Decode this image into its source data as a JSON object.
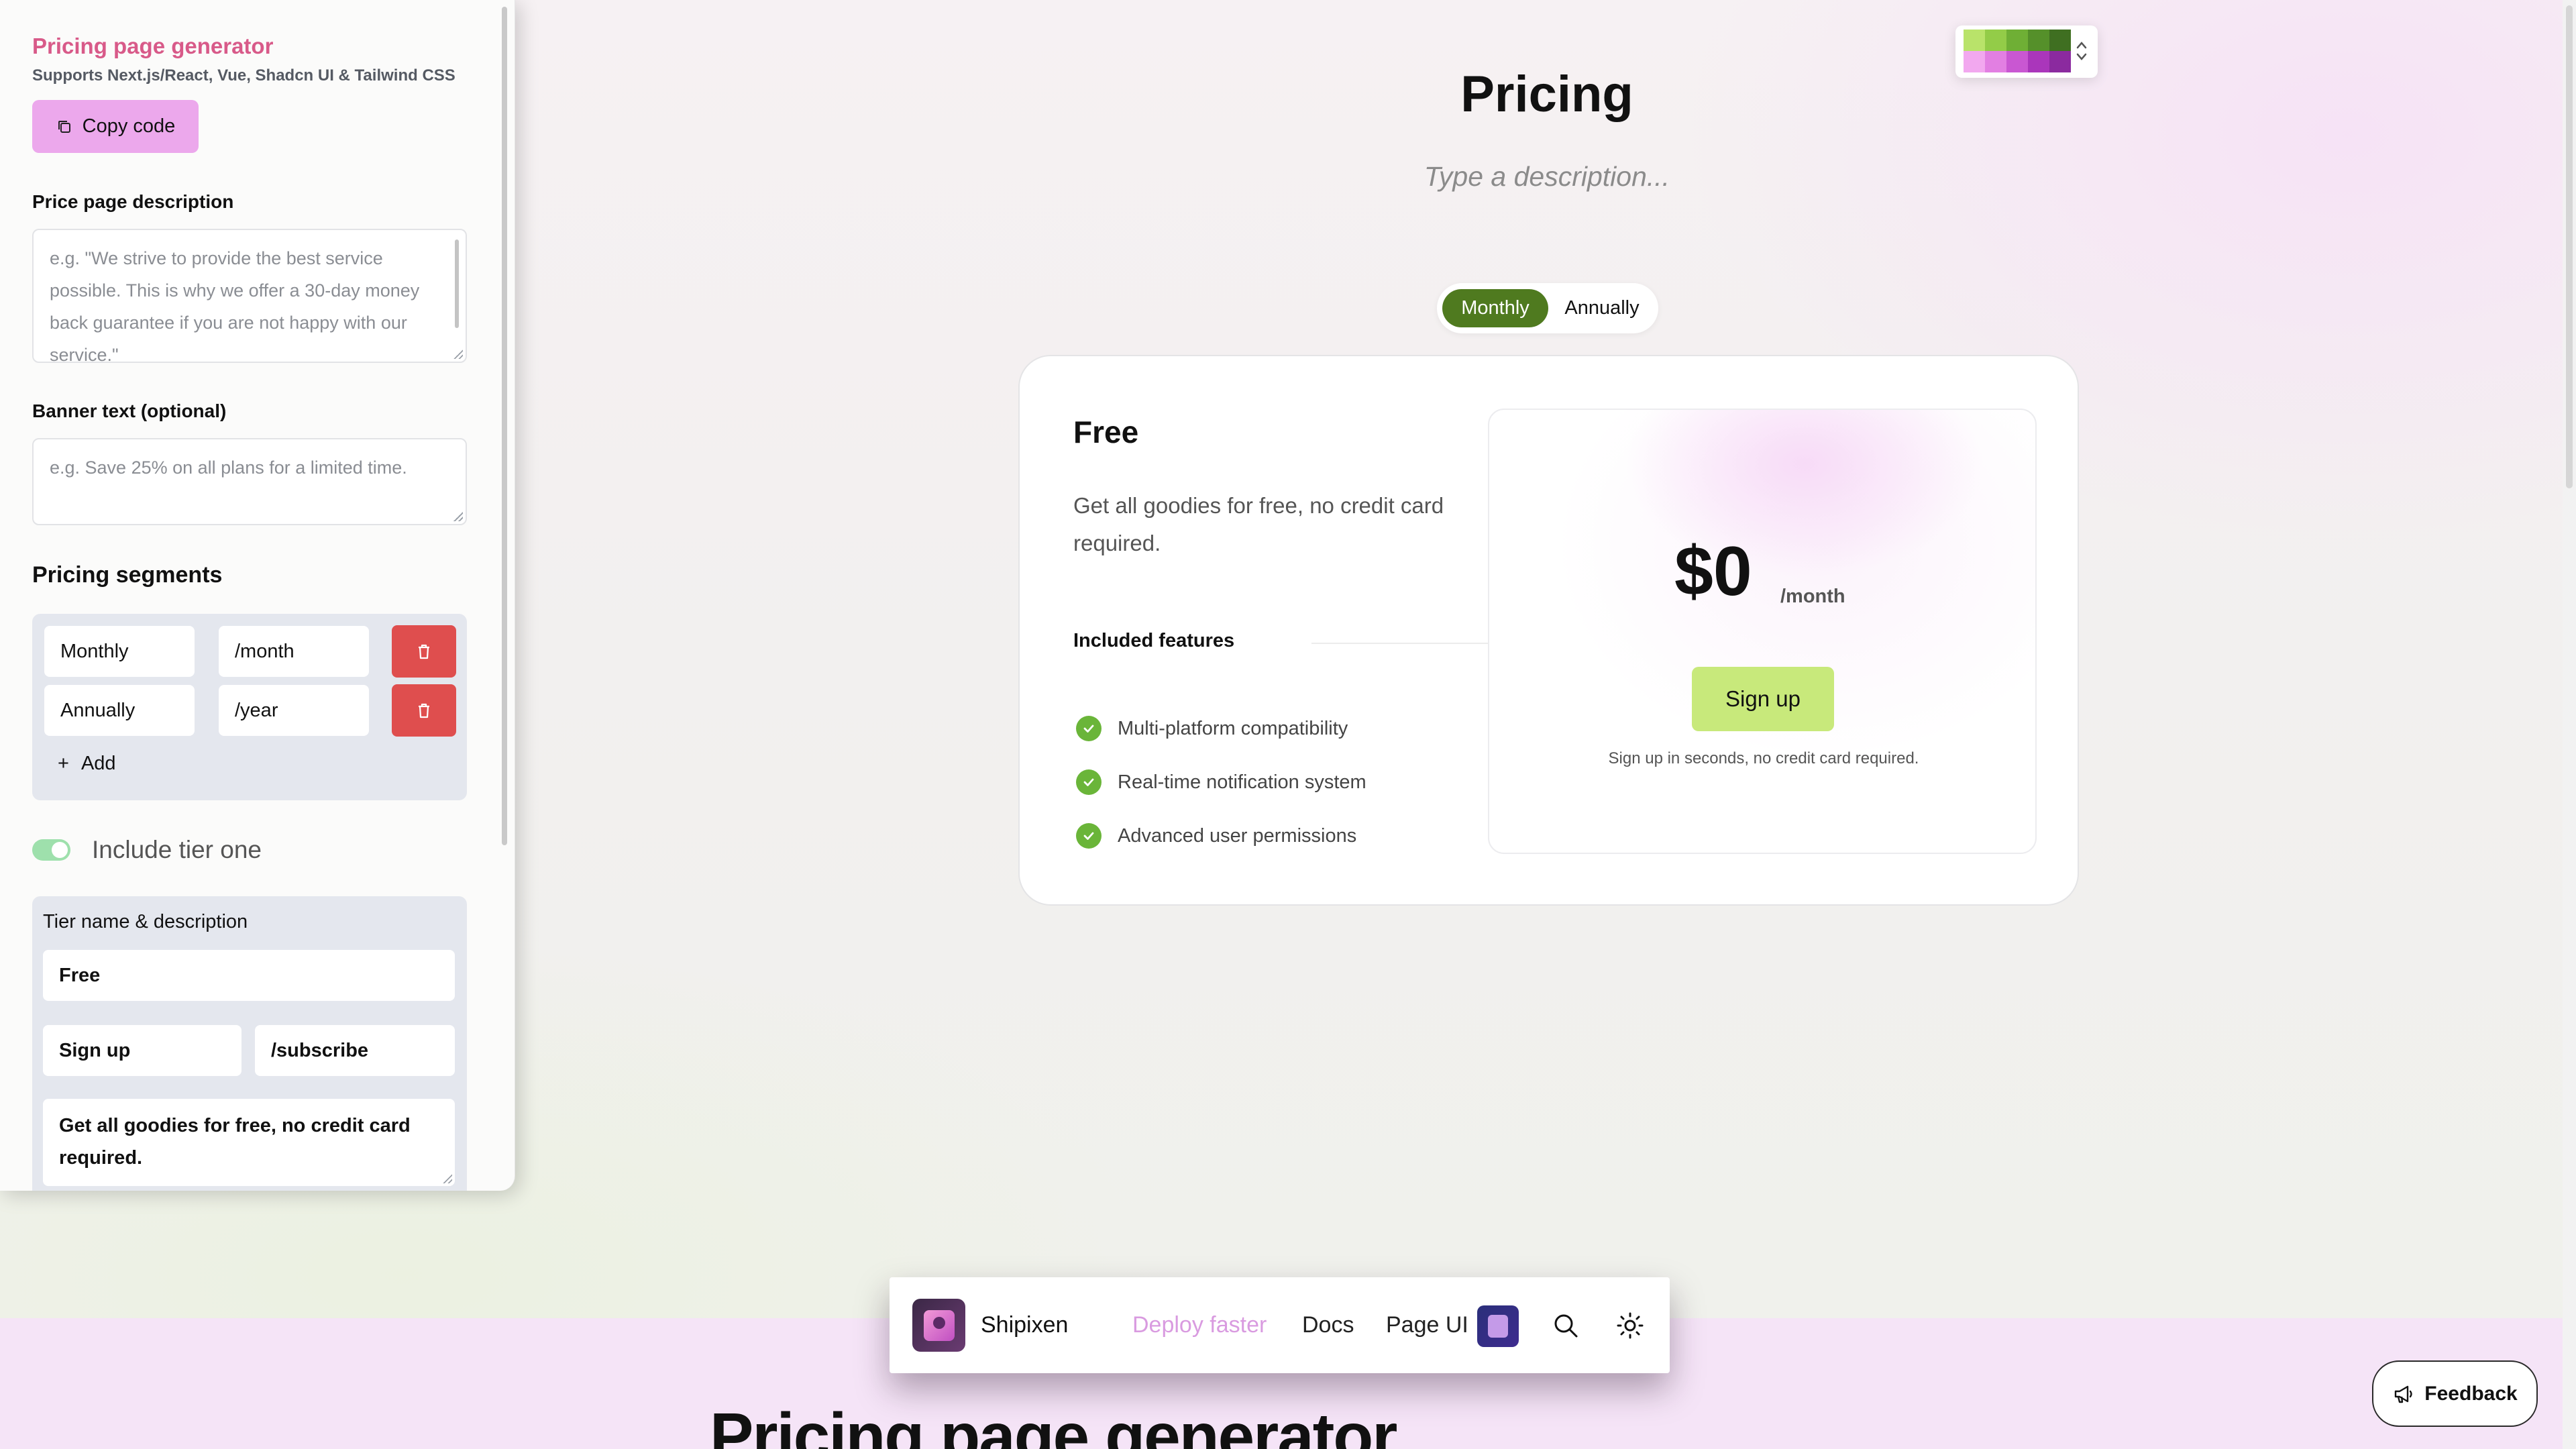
{
  "editor": {
    "title": "Pricing page generator",
    "subtitle": "Supports Next.js/React, Vue, Shadcn UI & Tailwind CSS",
    "copy_button": "Copy code",
    "description_label": "Price page description",
    "description_placeholder": "e.g. \"We strive to provide the best service possible. This is why we offer a 30-day money back guarantee if you are not happy with our service.\"",
    "banner_label": "Banner text (optional)",
    "banner_placeholder": "e.g. Save 25% on all plans for a limited time.",
    "segments_heading": "Pricing segments",
    "segments": [
      {
        "name": "Monthly",
        "suffix": "/month"
      },
      {
        "name": "Annually",
        "suffix": "/year"
      }
    ],
    "add_label": "Add",
    "include_tier_label": "Include tier one",
    "include_tier_on": true,
    "tier": {
      "section_label": "Tier name & description",
      "name": "Free",
      "button_text": "Sign up",
      "button_link": "/subscribe",
      "description": "Get all goodies for free, no credit card required."
    }
  },
  "main": {
    "heading": "Pricing",
    "description_placeholder": "Type a description...",
    "palette_colors": [
      "#b9e36a",
      "#93cc48",
      "#6faf35",
      "#55902a",
      "#3f6f21",
      "#f2a8ef",
      "#e27fe2",
      "#c957d2",
      "#aa36bb",
      "#8b2a9f"
    ],
    "segment_toggle": {
      "active": "Monthly",
      "inactive": "Annually"
    },
    "plan": {
      "name": "Free",
      "description": "Get all goodies for free, no credit card required.",
      "features_heading": "Included features",
      "features": [
        "Multi-platform compatibility",
        "Real-time notification system",
        "Advanced user permissions"
      ],
      "price": "$0",
      "period": "/month",
      "cta": "Sign up",
      "cta_note": "Sign up in seconds, no credit card required."
    }
  },
  "navbar": {
    "brand": "Shipixen",
    "links": [
      "Deploy faster",
      "Docs",
      "Page UI"
    ],
    "link_colors": [
      "#d99be0",
      "#222222",
      "#222222"
    ]
  },
  "footer": {
    "big_heading": "Pricing page generator",
    "feedback": "Feedback"
  }
}
